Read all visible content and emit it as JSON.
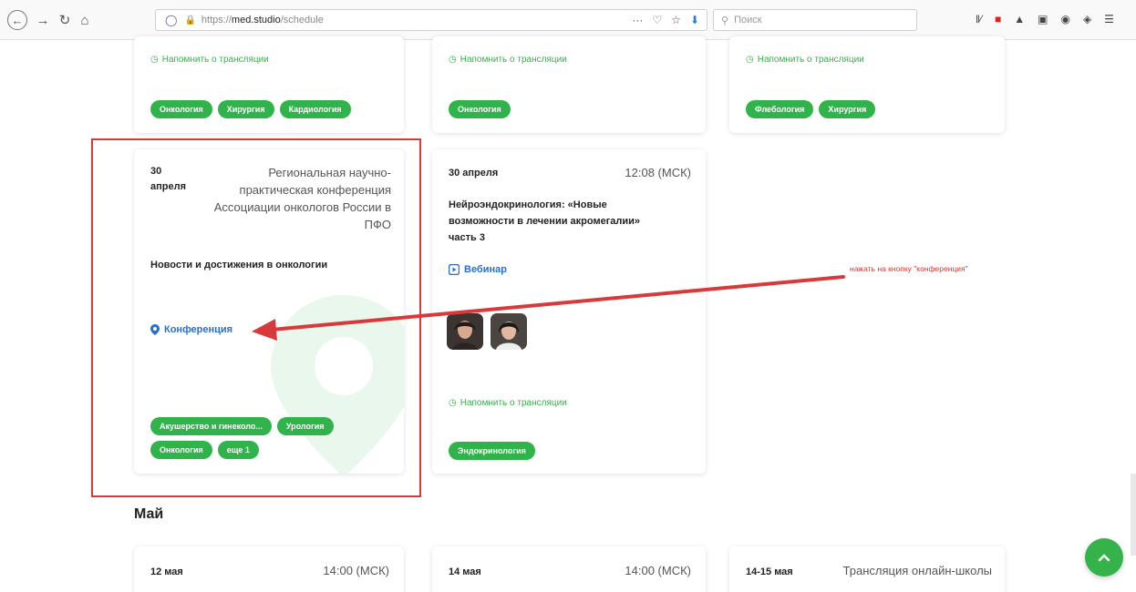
{
  "browser": {
    "url_prefix": "https://",
    "url_domain": "med.studio",
    "url_path": "/schedule",
    "search_placeholder": "Поиск",
    "menu_dots": "···"
  },
  "reminder_label": "Напомнить о трансляции",
  "top_cards": [
    {
      "tags": [
        "Онкология",
        "Хирургия",
        "Кардиология"
      ]
    },
    {
      "tags": [
        "Онкология"
      ]
    },
    {
      "tags": [
        "Флебология",
        "Хирургия"
      ]
    }
  ],
  "card_conference": {
    "date_day": "30",
    "date_month": "апреля",
    "title": "Региональная научно-практическая конференция Ассоциации онкологов России в ПФО",
    "title_lines": [
      "Региональная научно-",
      "практическая конференция",
      "Ассоциации онкологов России в",
      "ПФО"
    ],
    "description": "Новости и достижения в онкологии",
    "type_label": "Конференция",
    "tags": [
      "Акушерство и гинеколо...",
      "Урология",
      "Онкология",
      "еще 1"
    ]
  },
  "card_webinar": {
    "date": "30 апреля",
    "time": "12:08 (МСК)",
    "desc_lines": [
      "Нейроэндокринология: «Новые",
      "возможности в лечении акромегалии»",
      "часть 3"
    ],
    "type_label": "Вебинар",
    "tags": [
      "Эндокринология"
    ]
  },
  "annotation": "нажать на кнопку \"конференция\"",
  "colors": {
    "green": "#2fb34a",
    "blue": "#2a6fc9",
    "red": "#d63a3a"
  },
  "section_may": "Май",
  "may_cards": [
    {
      "date": "12 мая",
      "time": "14:00 (МСК)"
    },
    {
      "date": "14 мая",
      "time": "14:00 (МСК)"
    },
    {
      "date": "14-15 мая",
      "title": "Трансляция онлайн-школы"
    }
  ]
}
